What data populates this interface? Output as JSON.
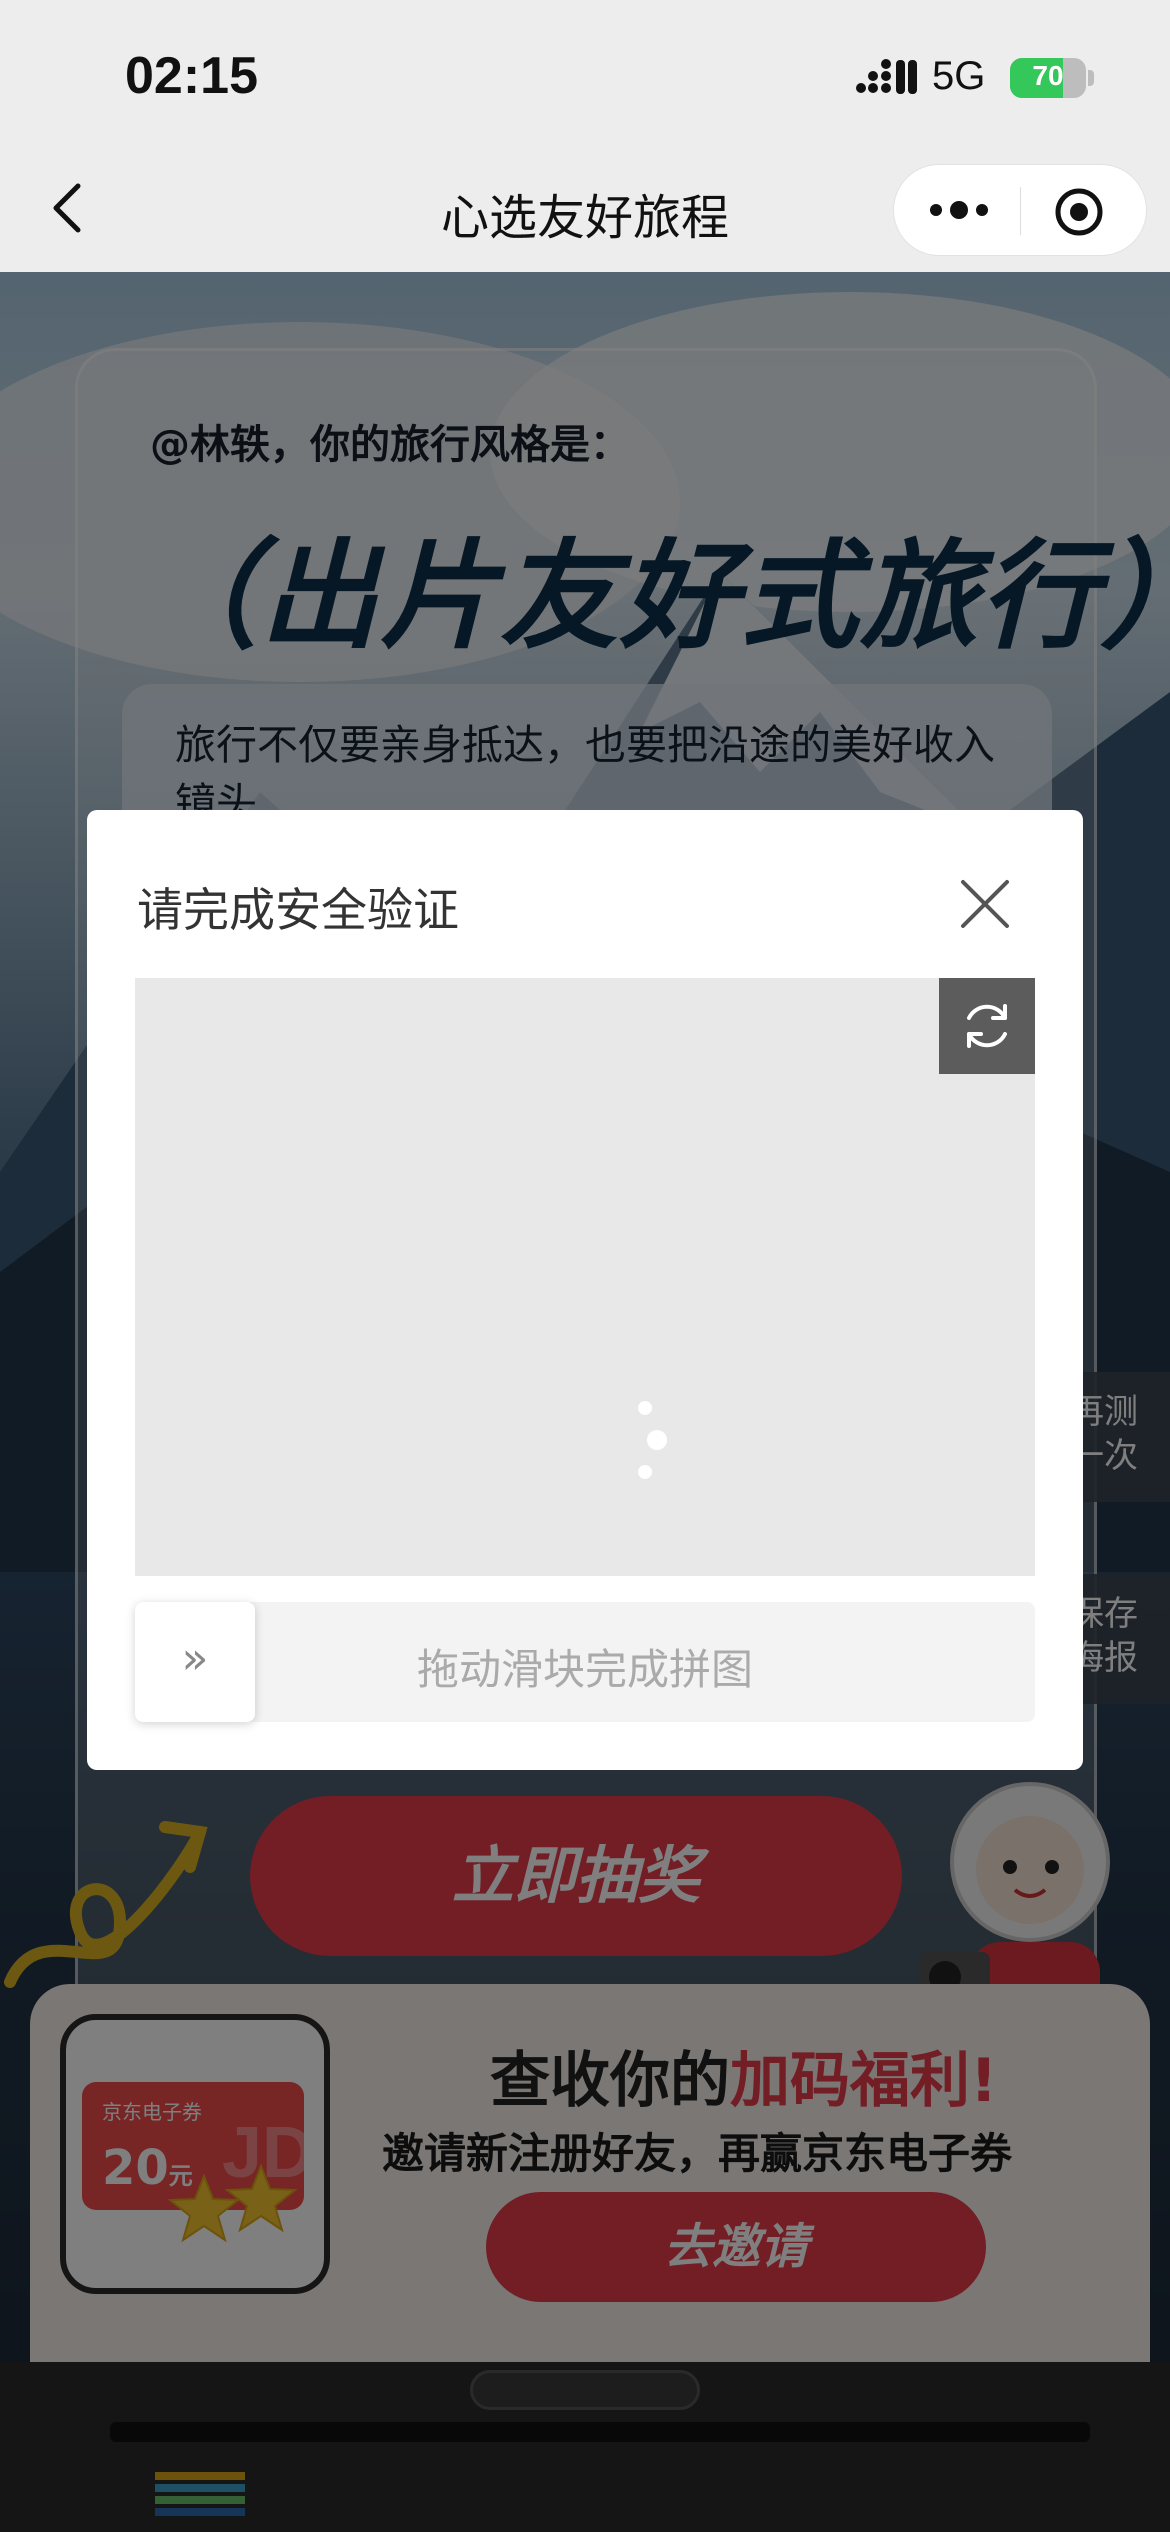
{
  "status_bar": {
    "time": "02:15",
    "network": "5G",
    "battery": "70"
  },
  "nav": {
    "title": "心选友好旅程"
  },
  "card": {
    "greeting": "@林轶，你的旅行风格是：",
    "style_title": "（出片友好式旅行）",
    "description": "旅行不仅要亲身抵达，也要把沿途的美好收入镜头"
  },
  "side_tabs": {
    "retest": "再测一次",
    "save_poster": "保存海报"
  },
  "lottery_button": "立即抽奖",
  "benefit": {
    "coupon_title": "京东电子券",
    "coupon_amount": "20",
    "coupon_unit": "元",
    "coupon_logo": "JD",
    "title_prefix": "查收你的",
    "title_accent": "加码福利",
    "title_suffix": "!",
    "subtitle": "邀请新注册好友，再赢京东电子券",
    "invite_button": "去邀请"
  },
  "dialog": {
    "title": "请完成安全验证",
    "slider_hint": "拖动滑块完成拼图",
    "handle_glyph": "»"
  },
  "colors": {
    "accent_red": "#e63a4a",
    "battery_green": "#34c759",
    "nav_bg": "#ededed"
  },
  "icons": [
    "back-chevron-icon",
    "more-dots-icon",
    "target-icon",
    "close-icon",
    "refresh-icon",
    "loading-spinner-icon"
  ]
}
